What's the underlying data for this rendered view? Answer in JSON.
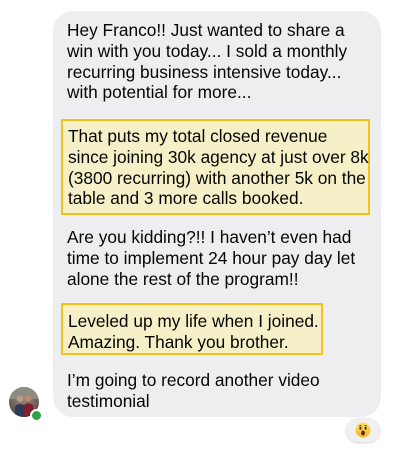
{
  "conversation": {
    "messages": [
      {
        "text": "Hey Franco!! Just wanted to share a win with you today... I sold a monthly recurring business intensive today... with potential for more...",
        "highlighted": false
      },
      {
        "text": "That puts my total closed revenue since joining 30k agency at just over 8k (3800 recurring) with another 5k on the table and 3 more calls booked.",
        "highlighted": true
      },
      {
        "text": "Are you kidding?!! I haven’t even had time to implement 24 hour pay day let alone the rest of the program!!",
        "highlighted": false
      },
      {
        "text": "Leveled up my life when I joined. Amazing. Thank you brother.",
        "highlighted": true
      },
      {
        "text": "I’m going to record another video testimonial",
        "highlighted": false
      }
    ],
    "sender": {
      "avatar_icon": "user-photo-avatar",
      "online": true,
      "status_color": "#31a24c"
    },
    "reaction": {
      "emoji_icon": "wow-face-emoji-icon"
    }
  },
  "colors": {
    "bubble": "#eeeef0",
    "highlight_fill": "#f6f0c8",
    "highlight_border": "#f2c21b"
  }
}
